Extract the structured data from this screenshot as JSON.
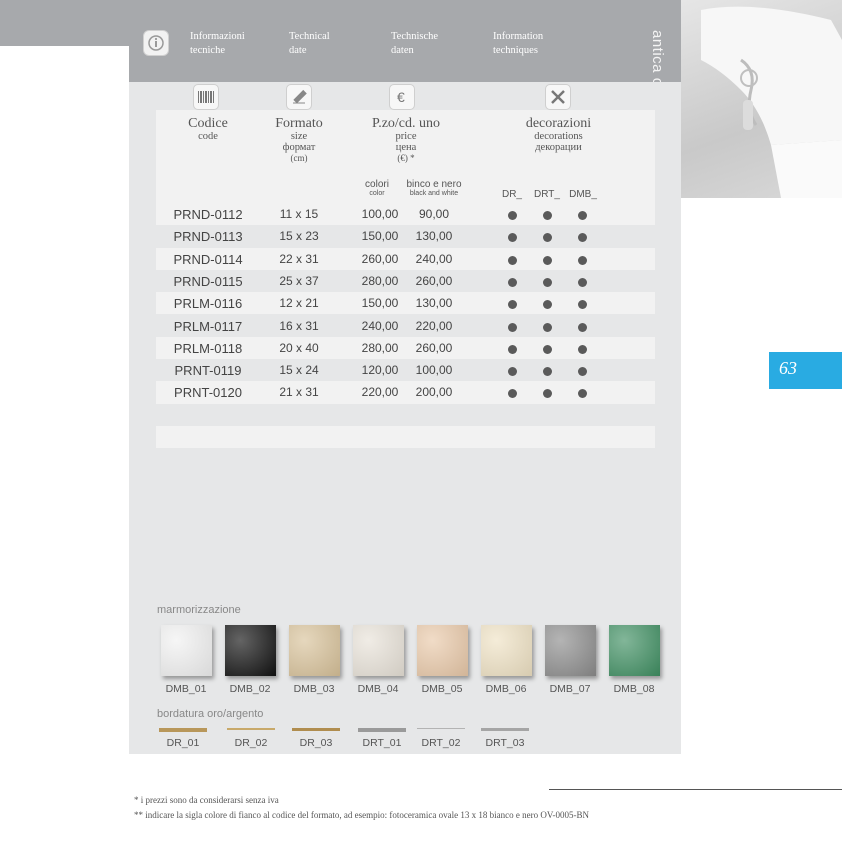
{
  "header": {
    "labels": [
      {
        "line1": "Informazioni",
        "line2": "tecniche"
      },
      {
        "line1": "Technical",
        "line2": "date"
      },
      {
        "line1": "Technische",
        "line2": "daten"
      },
      {
        "line1": "Information",
        "line2": "techniques"
      }
    ],
    "vertical_title": "antica onda olimpo"
  },
  "table": {
    "headers": {
      "code": {
        "main": "Codice",
        "sub": "code"
      },
      "size": {
        "main": "Formato",
        "sub1": "size",
        "sub2": "формат",
        "sub3": "(cm)"
      },
      "price": {
        "main": "P.zo/cd. uno",
        "sub1": "price",
        "sub2": "цена",
        "sub3": "(€) *"
      },
      "decor": {
        "main": "decorazioni",
        "sub1": "decorations",
        "sub2": "декорации"
      },
      "colori": {
        "main": "colori",
        "sub": "color"
      },
      "bianco": {
        "main": "binco e nero",
        "sub": "black and white"
      },
      "dec_cols": [
        "DR_",
        "DRT_",
        "DMB_"
      ]
    },
    "rows": [
      {
        "code": "PRND-0112",
        "size": "11 x 15",
        "color": "100,00",
        "bw": "90,00"
      },
      {
        "code": "PRND-0113",
        "size": "15 x 23",
        "color": "150,00",
        "bw": "130,00"
      },
      {
        "code": "PRND-0114",
        "size": "22 x 31",
        "color": "260,00",
        "bw": "240,00"
      },
      {
        "code": "PRND-0115",
        "size": "25 x 37",
        "color": "280,00",
        "bw": "260,00"
      },
      {
        "code": "PRLM-0116",
        "size": "12 x 21",
        "color": "150,00",
        "bw": "130,00"
      },
      {
        "code": "PRLM-0117",
        "size": "16 x 31",
        "color": "240,00",
        "bw": "220,00"
      },
      {
        "code": "PRLM-0118",
        "size": "20 x 40",
        "color": "280,00",
        "bw": "260,00"
      },
      {
        "code": "PRNT-0119",
        "size": "15 x 24",
        "color": "120,00",
        "bw": "100,00"
      },
      {
        "code": "PRNT-0120",
        "size": "21 x 31",
        "color": "220,00",
        "bw": "200,00"
      }
    ]
  },
  "marble": {
    "title": "marmorizzazione",
    "items": [
      {
        "label": "DMB_01",
        "color": "#f1f1f1"
      },
      {
        "label": "DMB_02",
        "color": "#111111"
      },
      {
        "label": "DMB_03",
        "color": "#d8c29a"
      },
      {
        "label": "DMB_04",
        "color": "#e8e2d8"
      },
      {
        "label": "DMB_05",
        "color": "#e9c9a9"
      },
      {
        "label": "DMB_06",
        "color": "#efe2c4"
      },
      {
        "label": "DMB_07",
        "color": "#8c8c8c"
      },
      {
        "label": "DMB_08",
        "color": "#3f8f62"
      }
    ]
  },
  "borders": {
    "title": "bordatura oro/argento",
    "items": [
      {
        "label": "DR_01",
        "color": "#b8975a"
      },
      {
        "label": "DR_02",
        "color": "#c8a96a"
      },
      {
        "label": "DR_03",
        "color": "#b08d4f"
      },
      {
        "label": "DRT_01",
        "color": "#9a9a9a"
      },
      {
        "label": "DRT_02",
        "color": "#b3b3b3"
      },
      {
        "label": "DRT_03",
        "color": "#a5a5a5"
      }
    ]
  },
  "page_number": "63",
  "footnotes": [
    "* i prezzi sono da considerarsi senza iva",
    "** indicare la sigla colore di fianco al codice del formato, ad esempio: fotoceramica ovale 13 x 18 bianco e nero OV-0005-BN"
  ]
}
